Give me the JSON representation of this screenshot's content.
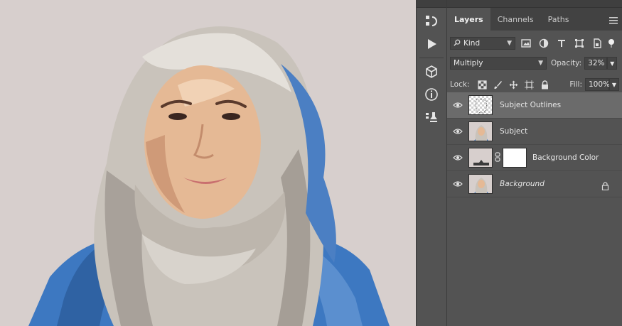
{
  "panel": {
    "tabs": [
      {
        "label": "Layers",
        "active": true
      },
      {
        "label": "Channels",
        "active": false
      },
      {
        "label": "Paths",
        "active": false
      }
    ],
    "filter": {
      "label": "Kind"
    },
    "blend_mode": "Multiply",
    "opacity_label": "Opacity:",
    "opacity_value": "32%",
    "lock_label": "Lock:",
    "fill_label": "Fill:",
    "fill_value": "100%",
    "layers": [
      {
        "name": "Subject Outlines",
        "selected": true
      },
      {
        "name": "Subject",
        "selected": false
      },
      {
        "name": "Background Color",
        "selected": false
      },
      {
        "name": "Background",
        "selected": false,
        "italic": true,
        "locked": true
      }
    ]
  },
  "colors": {
    "canvas_bg": "#d7cfcd",
    "panel_bg": "#535353",
    "selected_layer": "#6b6b6b",
    "shirt_blue": "#3d78c1",
    "hijab": "#c9c3bb",
    "skin": "#e5b995"
  }
}
